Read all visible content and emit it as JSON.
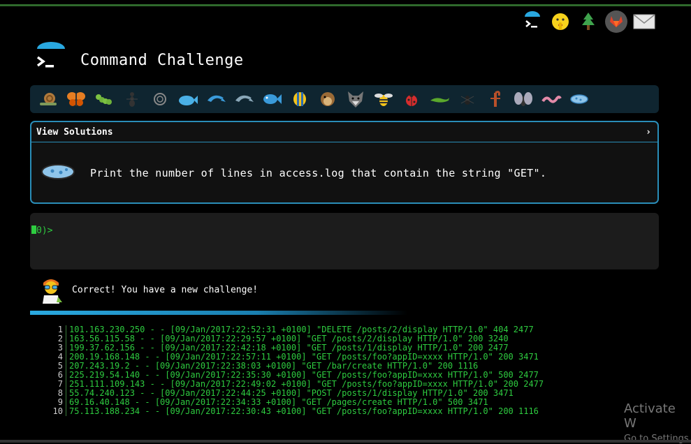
{
  "header": {
    "title": "Command Challenge"
  },
  "top_icons": [
    "terminal-icon",
    "shush-emoji-icon",
    "tree-icon",
    "gitlab-icon",
    "mail-icon"
  ],
  "creatures": [
    "snail-icon",
    "butterfly-icon",
    "caterpillar-icon",
    "ant-icon",
    "shell-icon",
    "whale-icon",
    "dolphin-icon",
    "dolphin-icon",
    "fish-icon",
    "tropical-fish-icon",
    "puffer-fish-icon",
    "wolf-icon",
    "bee-icon",
    "ladybug-icon",
    "lizard-icon",
    "spider-icon",
    "scorpion-icon",
    "fly-icon",
    "worm-icon",
    "microbe-icon"
  ],
  "solutions": {
    "label": "View Solutions",
    "toggle": "›"
  },
  "challenge": {
    "text": "Print the number of lines in access.log that contain the string \"GET\"."
  },
  "terminal": {
    "prompt": "0)>"
  },
  "feedback": {
    "text": "Correct! You have a new challenge!"
  },
  "log": {
    "lines": [
      {
        "n": "1",
        "text": "101.163.230.250 - - [09/Jan/2017:22:52:31 +0100] \"DELETE /posts/2/display HTTP/1.0\" 404 2477"
      },
      {
        "n": "2",
        "text": "163.56.115.58 - - [09/Jan/2017:22:29:57 +0100] \"GET /posts/2/display HTTP/1.0\" 200 3240"
      },
      {
        "n": "3",
        "text": "199.37.62.156 - - [09/Jan/2017:22:42:18 +0100] \"GET /posts/1/display HTTP/1.0\" 200 2477"
      },
      {
        "n": "4",
        "text": "200.19.168.148 - - [09/Jan/2017:22:57:11 +0100] \"GET /posts/foo?appID=xxxx HTTP/1.0\" 200 3471"
      },
      {
        "n": "5",
        "text": "207.243.19.2 - - [09/Jan/2017:22:38:03 +0100] \"GET /bar/create HTTP/1.0\" 200 1116"
      },
      {
        "n": "6",
        "text": "225.219.54.140 - - [09/Jan/2017:22:35:30 +0100] \"GET /posts/foo?appID=xxxx HTTP/1.0\" 500 2477"
      },
      {
        "n": "7",
        "text": "251.111.109.143 - - [09/Jan/2017:22:49:02 +0100] \"GET /posts/foo?appID=xxxx HTTP/1.0\" 200 2477"
      },
      {
        "n": "8",
        "text": "55.74.240.123 - - [09/Jan/2017:22:44:25 +0100] \"POST /posts/1/display HTTP/1.0\" 200 3471"
      },
      {
        "n": "9",
        "text": "69.16.40.148 - - [09/Jan/2017:22:34:33 +0100] \"GET /pages/create HTTP/1.0\" 500 3471"
      },
      {
        "n": "10",
        "text": "75.113.188.234 - - [09/Jan/2017:22:30:43 +0100] \"GET /posts/foo?appID=xxxx HTTP/1.0\" 200 1116"
      }
    ]
  },
  "watermark": {
    "line1": "Activate W",
    "line2": "Go to Settings"
  },
  "colors": {
    "accent": "#2a8db8",
    "terminal_green": "#2ecc40"
  }
}
